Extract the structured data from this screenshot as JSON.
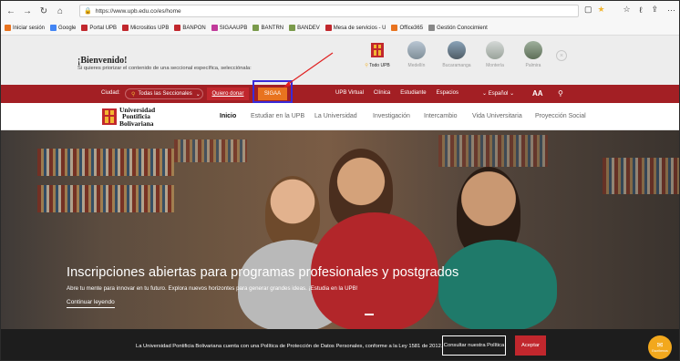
{
  "browser": {
    "url": "https://www.upb.edu.co/es/home",
    "icons": {
      "back": "←",
      "forward": "→",
      "refresh": "↻",
      "home": "⌂",
      "reader": "▢",
      "star": "★",
      "favorites": "☆",
      "collections": "ℓ",
      "share": "⇪",
      "more": "···"
    },
    "star_color": "#f2b632"
  },
  "favorites": [
    {
      "label": "Iniciar sesión",
      "color": "#e8731f"
    },
    {
      "label": "Google",
      "color": "#4285f4"
    },
    {
      "label": "Portal UPB",
      "color": "#c1272d"
    },
    {
      "label": "Micrositios UPB",
      "color": "#c1272d"
    },
    {
      "label": "BANPON",
      "color": "#c1272d"
    },
    {
      "label": "SIGAAUPB",
      "color": "#c13a9a"
    },
    {
      "label": "BANTRN",
      "color": "#7a9a4b"
    },
    {
      "label": "BANDEV",
      "color": "#7a9a4b"
    },
    {
      "label": "Mesa de servicios - U",
      "color": "#c1272d"
    },
    {
      "label": "Office365",
      "color": "#e8731f"
    },
    {
      "label": "Gestión Conocimient",
      "color": "#888888"
    }
  ],
  "welcome": {
    "title": "¡Bienvenido!",
    "subtitle": "Si quieres priorizar el contenido de una seccional específica, selecciónala:",
    "sedes": [
      {
        "label": "Todo UPB",
        "active": true
      },
      {
        "label": "Medellín",
        "active": false
      },
      {
        "label": "Bucaramanga",
        "active": false
      },
      {
        "label": "Montería",
        "active": false
      },
      {
        "label": "Palmira",
        "active": false
      }
    ],
    "close": "×"
  },
  "utility": {
    "city_label": "Ciudad:",
    "city_value": "Todas las Seccionales",
    "donate": "Quiero donar",
    "sigaa": "SIGAA",
    "links": [
      "UPB Virtual",
      "Clínica",
      "Estudiante",
      "Espacios"
    ],
    "language": "Español",
    "font_size": "AA",
    "search": "⚲",
    "bar_color": "#a31f24",
    "highlight_color": "#3a2bd8"
  },
  "nav": {
    "logo": [
      "Universidad",
      "Pontificia",
      "Bolivariana"
    ],
    "links": [
      "Inicio",
      "Estudiar en la UPB",
      "La Universidad",
      "Investigación",
      "Intercambio",
      "Vida Universitaria",
      "Proyección Social"
    ],
    "active": "Inicio"
  },
  "hero": {
    "title": "Inscripciones abiertas para programas profesionales y postgrados",
    "subtitle": "Abre tu mente para innovar en tu futuro. Explora nuevos horizontes para generar grandes ideas. ¡Estudia en la UPB!",
    "link": "Continuar leyendo"
  },
  "cookie": {
    "text": "La Universidad Pontificia Bolivariana cuenta con una Política de Protección de Datos Personales, conforme a la Ley 1581 de 2012.",
    "policy_button": "Consultar nuestra Política",
    "accept_button": "Aceptar",
    "chat_label": "Escríbenos"
  }
}
